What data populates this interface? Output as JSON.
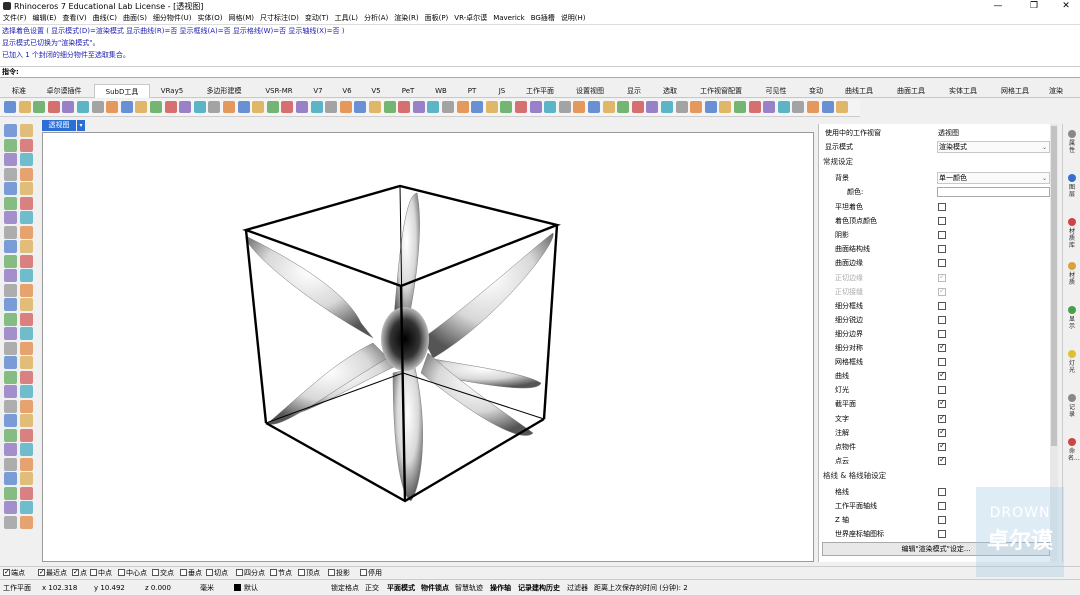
{
  "window": {
    "title": "Rhinoceros 7 Educational Lab License - [透视图]",
    "minimize": "—",
    "maximize": "❐",
    "close": "✕"
  },
  "menu": [
    "文件(F)",
    "编辑(E)",
    "查看(V)",
    "曲线(C)",
    "曲面(S)",
    "细分物件(U)",
    "实体(O)",
    "网格(M)",
    "尺寸标注(D)",
    "变动(T)",
    "工具(L)",
    "分析(A)",
    "渲染(R)",
    "面板(P)",
    "VR-卓尔谟",
    "Maverick",
    "BG插槽",
    "说明(H)"
  ],
  "command_history": [
    "选择着色设置 ( 显示模式(D)=渲染模式 显示曲线(R)=否 显示框线(A)=否 显示格线(W)=否 显示轴线(X)=否 )",
    "显示模式已切换为\"渲染模式\"。",
    "已加入 1 个封闭的细分物件至选取集合。"
  ],
  "command_prompt": "指令:",
  "tabs": [
    "标准",
    "卓尔谟插件",
    "SubD工具",
    "VRay5",
    "多边形建模",
    "VSR-MR",
    "V7",
    "V6",
    "V5",
    "PeT",
    "WB",
    "PT",
    "JS",
    "工作平面",
    "设置视图",
    "显示",
    "选取",
    "工作视窗配置",
    "可见性",
    "变动",
    "曲线工具",
    "曲面工具",
    "实体工具",
    "网格工具",
    "渲染"
  ],
  "active_tab": "SubD工具",
  "viewport": {
    "tab_label": "透视图",
    "dropdown": "▾"
  },
  "panel": {
    "viewport_label": "使用中的工作视窗",
    "viewport_value": "透视图",
    "display_mode_label": "显示模式",
    "display_mode_value": "渲染模式",
    "section_general": "常规设定",
    "background_label": "背景",
    "background_value": "单一颜色",
    "color_label": "颜色:",
    "checks": [
      {
        "label": "平坦着色",
        "on": false,
        "disabled": false
      },
      {
        "label": "着色顶点颜色",
        "on": false,
        "disabled": false
      },
      {
        "label": "阴影",
        "on": false,
        "disabled": false
      },
      {
        "label": "曲面结构线",
        "on": false,
        "disabled": false
      },
      {
        "label": "曲面边缘",
        "on": false,
        "disabled": false
      },
      {
        "label": "正切边缘",
        "on": true,
        "disabled": true
      },
      {
        "label": "正切接缝",
        "on": true,
        "disabled": true
      },
      {
        "label": "细分框线",
        "on": false,
        "disabled": false
      },
      {
        "label": "细分锐边",
        "on": false,
        "disabled": false
      },
      {
        "label": "细分边界",
        "on": false,
        "disabled": false
      },
      {
        "label": "细分对称",
        "on": true,
        "disabled": false
      },
      {
        "label": "网格框线",
        "on": false,
        "disabled": false
      },
      {
        "label": "曲线",
        "on": true,
        "disabled": false
      },
      {
        "label": "灯光",
        "on": false,
        "disabled": false
      },
      {
        "label": "截平面",
        "on": true,
        "disabled": false
      },
      {
        "label": "文字",
        "on": true,
        "disabled": false
      },
      {
        "label": "注解",
        "on": true,
        "disabled": false
      },
      {
        "label": "点物件",
        "on": true,
        "disabled": false
      },
      {
        "label": "点云",
        "on": true,
        "disabled": false
      }
    ],
    "section_grid": "格线 & 格线轴设定",
    "grid_checks": [
      {
        "label": "格线",
        "on": false
      },
      {
        "label": "工作平面轴线",
        "on": false
      },
      {
        "label": "Z 轴",
        "on": false
      },
      {
        "label": "世界座标轴图标",
        "on": false
      }
    ],
    "edit_button": "编辑\"渲染模式\"设定..."
  },
  "right_tabs": [
    "属性",
    "图层",
    "材质库",
    "材质",
    "显示",
    "灯光",
    "记录",
    "命名..."
  ],
  "snaps": [
    {
      "label": "端点",
      "on": true
    },
    {
      "label": "最近点",
      "on": true
    },
    {
      "label": "点",
      "on": true
    },
    {
      "label": "中点",
      "on": false
    },
    {
      "label": "中心点",
      "on": false
    },
    {
      "label": "交点",
      "on": false
    },
    {
      "label": "垂点",
      "on": false
    },
    {
      "label": "切点",
      "on": false
    },
    {
      "label": "四分点",
      "on": false
    },
    {
      "label": "节点",
      "on": false
    },
    {
      "label": "顶点",
      "on": false
    },
    {
      "label": "投影",
      "on": false
    },
    {
      "label": "停用",
      "on": false
    }
  ],
  "status": {
    "cplane": "工作平面",
    "x": "x 102.318",
    "y": "y 10.492",
    "z": "z 0.000",
    "unit": "毫米",
    "layer": "默认",
    "lock_grid": "锁定格点",
    "ortho": "正交",
    "planar": "平面模式",
    "osnap": "物件锁点",
    "smarttrack": "智慧轨迹",
    "gumball": "操作轴",
    "history": "记录建构历史",
    "filter": "过滤器",
    "autosave": "距离上次保存的时间 (分钟): 2"
  },
  "watermark": {
    "line1": "DROWN",
    "line2": "卓尔谟"
  },
  "colors": {
    "accent": "#2b6fd6",
    "cmd_text": "#1a1ab0"
  }
}
